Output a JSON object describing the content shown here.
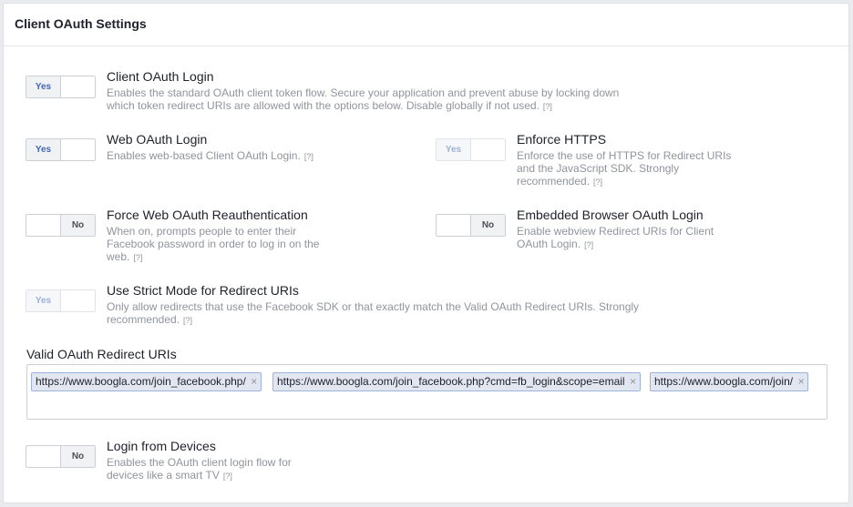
{
  "panel": {
    "title": "Client OAuth Settings"
  },
  "help_mark": "[?]",
  "settings": {
    "client_oauth_login": {
      "value": "Yes",
      "title": "Client OAuth Login",
      "desc": "Enables the standard OAuth client token flow. Secure your application and prevent abuse by locking down which token redirect URIs are allowed with the options below. Disable globally if not used."
    },
    "web_oauth_login": {
      "value": "Yes",
      "title": "Web OAuth Login",
      "desc": "Enables web-based Client OAuth Login."
    },
    "enforce_https": {
      "value": "Yes",
      "title": "Enforce HTTPS",
      "desc": "Enforce the use of HTTPS for Redirect URIs and the JavaScript SDK. Strongly recommended."
    },
    "force_reauth": {
      "value": "No",
      "title": "Force Web OAuth Reauthentication",
      "desc": "When on, prompts people to enter their Facebook password in order to log in on the web."
    },
    "embedded_browser": {
      "value": "No",
      "title": "Embedded Browser OAuth Login",
      "desc": "Enable webview Redirect URIs for Client OAuth Login."
    },
    "strict_mode": {
      "value": "Yes",
      "title": "Use Strict Mode for Redirect URIs",
      "desc": "Only allow redirects that use the Facebook SDK or that exactly match the Valid OAuth Redirect URIs. Strongly recommended."
    },
    "login_from_devices": {
      "value": "No",
      "title": "Login from Devices",
      "desc": "Enables the OAuth client login flow for devices like a smart TV"
    }
  },
  "redirect_uris": {
    "label": "Valid OAuth Redirect URIs",
    "items": [
      "https://www.boogla.com/join_facebook.php/",
      "https://www.boogla.com/join_facebook.php?cmd=fb_login&scope=email",
      "https://www.boogla.com/join/"
    ],
    "remove_glyph": "×"
  }
}
